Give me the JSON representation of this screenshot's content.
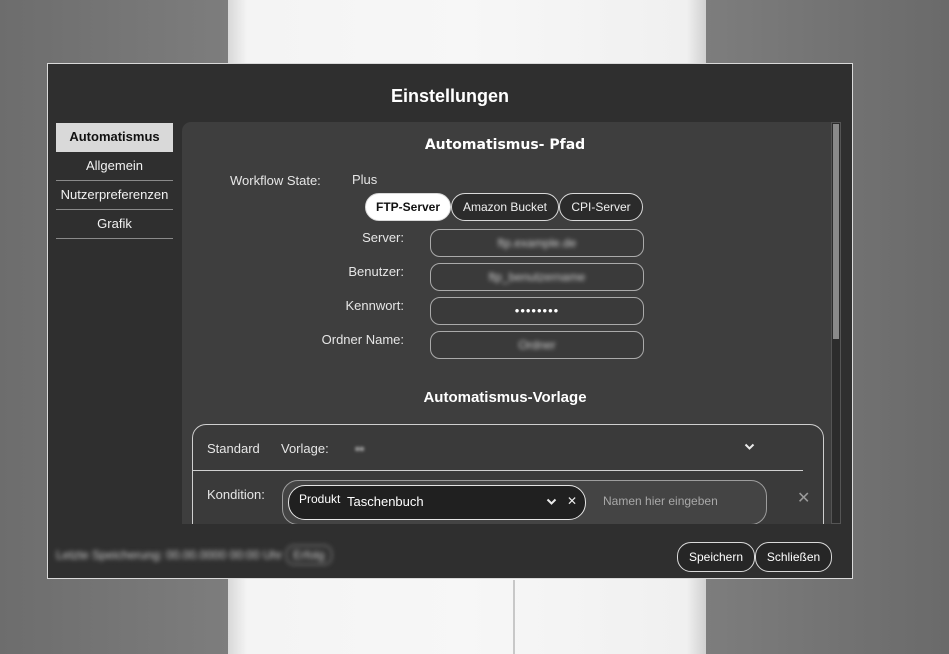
{
  "dialog": {
    "title": "Einstellungen"
  },
  "sidebar": {
    "items": [
      {
        "label": "Automatismus",
        "active": true
      },
      {
        "label": "Allgemein",
        "active": false
      },
      {
        "label": "Nutzerpreferenzen",
        "active": false
      },
      {
        "label": "Grafik",
        "active": false
      }
    ]
  },
  "path_section": {
    "heading": "Automatismus- Pfad",
    "workflow_state_label": "Workflow State:",
    "workflow_state_value": "Plus",
    "targets": [
      {
        "label": "FTP-Server",
        "active": true
      },
      {
        "label": "Amazon Bucket",
        "active": false
      },
      {
        "label": "CPI-Server",
        "active": false
      }
    ],
    "fields": {
      "server_label": "Server:",
      "server_value": "ftp.example.de",
      "user_label": "Benutzer:",
      "user_value": "ftp_benutzername",
      "password_label": "Kennwort:",
      "password_value": "••••••••",
      "folder_label": "Ordner Name:",
      "folder_value": "Ordner"
    }
  },
  "template_section": {
    "heading": "Automatismus-Vorlage",
    "standard_label": "Standard",
    "template_label": "Vorlage:",
    "template_value": "▪▪",
    "condition_label": "Kondition:",
    "condition_field": "Produkt",
    "condition_value": "Taschenbuch",
    "name_placeholder": "Namen hier eingeben"
  },
  "footer": {
    "status_text": "Letzte Speicherung: 00.00.0000 00:00 Uhr",
    "status_badge": "Erfolg",
    "save_label": "Speichern",
    "close_label": "Schließen"
  },
  "colors": {
    "dialog_bg": "#2f2f2f",
    "content_bg": "#3e3e3e",
    "active_tab_bg": "#d9d9d9",
    "active_pill_bg": "#ffffff"
  },
  "icons": {
    "dropdown": "chevron-down-icon",
    "clear": "clear-x-icon",
    "remove_condition": "close-icon"
  }
}
